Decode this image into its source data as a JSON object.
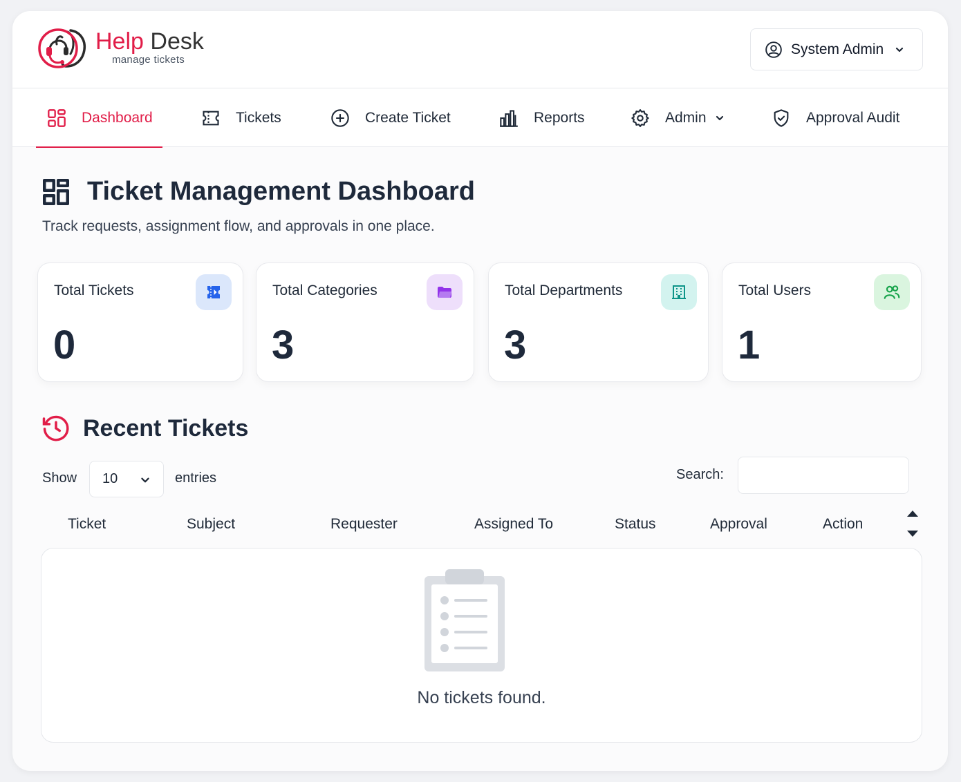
{
  "app": {
    "title_part1": "Help",
    "title_part2": "Desk",
    "subtitle": "manage tickets"
  },
  "user": {
    "name": "System Admin"
  },
  "nav": [
    {
      "label": "Dashboard",
      "icon": "dashboard-icon",
      "active": true
    },
    {
      "label": "Tickets",
      "icon": "ticket-icon"
    },
    {
      "label": "Create Ticket",
      "icon": "plus-circle-icon"
    },
    {
      "label": "Reports",
      "icon": "bar-chart-icon"
    },
    {
      "label": "Admin",
      "icon": "gear-icon"
    },
    {
      "label": "Approval Audit",
      "icon": "shield-check-icon"
    }
  ],
  "page": {
    "title": "Ticket Management Dashboard",
    "subtitle": "Track requests, assignment flow, and approvals in one place."
  },
  "stats": [
    {
      "label": "Total Tickets",
      "value": "0",
      "icon": "ticket-icon",
      "color": "#2563eb",
      "bg": "#dbe7fb"
    },
    {
      "label": "Total Categories",
      "value": "3",
      "icon": "folder-icon",
      "color": "#9333ea",
      "bg": "#eedffb"
    },
    {
      "label": "Total Departments",
      "value": "3",
      "icon": "building-icon",
      "color": "#0d9488",
      "bg": "#d3f3ef"
    },
    {
      "label": "Total Users",
      "value": "1",
      "icon": "users-icon",
      "color": "#16a34a",
      "bg": "#daf5df"
    }
  ],
  "recent": {
    "title": "Recent Tickets",
    "show_label": "Show",
    "page_size": "10",
    "entries_label": "entries",
    "search_label": "Search:",
    "search_value": "",
    "columns": [
      "Ticket",
      "Subject",
      "Requester",
      "Assigned To",
      "Status",
      "Approval",
      "Action"
    ],
    "empty_message": "No tickets found."
  },
  "colors": {
    "accent": "#e11d48",
    "text_dark": "#1e293b"
  }
}
